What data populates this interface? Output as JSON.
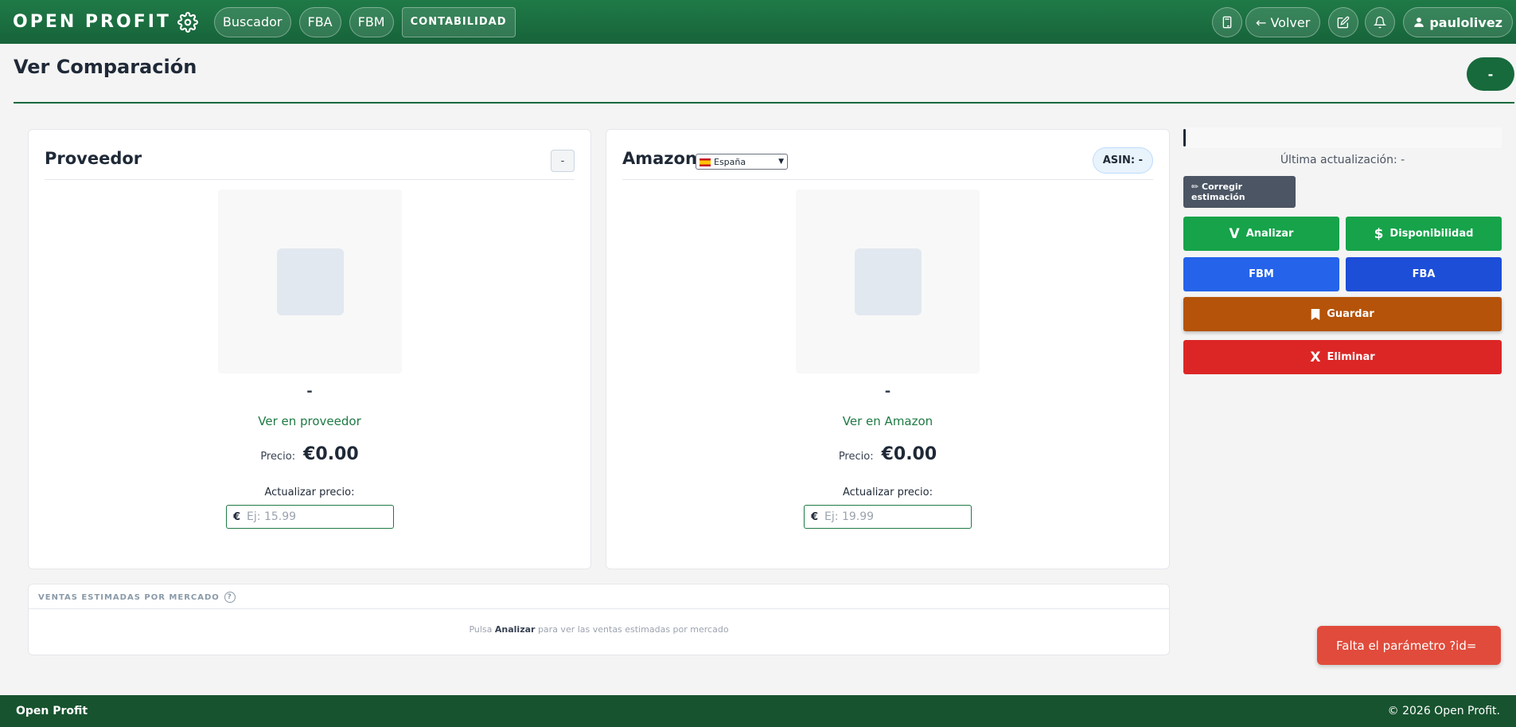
{
  "header": {
    "brand": "OPEN PROFIT",
    "nav": [
      "Buscador",
      "FBA",
      "FBM"
    ],
    "contabilidad": "CONTABILIDAD",
    "back_label": "← Volver",
    "user": "paulolivez"
  },
  "page": {
    "title": "Ver Comparación",
    "header_button": "-"
  },
  "proveedor": {
    "title": "Proveedor",
    "mini_button": "-",
    "product_name": "-",
    "link": "Ver en proveedor",
    "price_label": "Precio:",
    "price_value": "€0.00",
    "update_label": "Actualizar precio:",
    "currency": "€",
    "input_placeholder": "Ej: 15.99"
  },
  "amazon": {
    "title": "Amazon",
    "country": "España",
    "asin_badge": "ASIN: -",
    "product_name": "-",
    "link": "Ver en Amazon",
    "price_label": "Precio:",
    "price_value": "€0.00",
    "update_label": "Actualizar precio:",
    "currency": "€",
    "input_placeholder": "Ej: 19.99"
  },
  "ventas": {
    "title": "VENTAS ESTIMADAS POR MERCADO",
    "help": "?",
    "msg_prefix": "Pulsa",
    "msg_bold": "Analizar",
    "msg_suffix": "para ver las ventas estimadas por mercado"
  },
  "panel": {
    "last_update": "Última actualización: -",
    "corregir": "✏ Corregir estimación",
    "analizar_sym": "V",
    "analizar": "Analizar",
    "disponibilidad_sym": "$",
    "disponibilidad": "Disponibilidad",
    "fbm": "FBM",
    "fba": "FBA",
    "guardar": "Guardar",
    "eliminar_sym": "X",
    "eliminar": "Eliminar"
  },
  "toast": "Falta el parámetro ?id=",
  "footer": {
    "left": "Open Profit",
    "right": "© 2026 Open Profit."
  },
  "colors": {
    "brand_green": "#17633a",
    "analizar": "#16a34a",
    "fbm": "#2563eb",
    "fba": "#1d4ed8",
    "guardar": "#b45309",
    "eliminar": "#dc2626",
    "corregir": "#4b5563",
    "toast": "#e14b3b"
  }
}
